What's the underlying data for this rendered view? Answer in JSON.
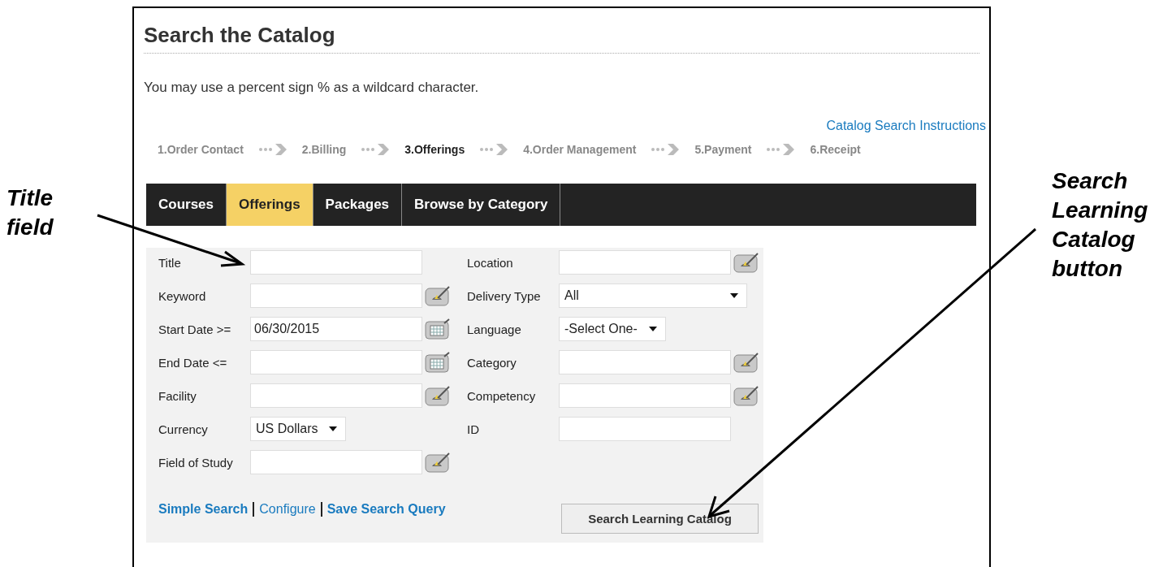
{
  "callouts": [
    {
      "text": "Title field"
    },
    {
      "text": "Search Learning Catalog button"
    }
  ],
  "page": {
    "title": "Search the Catalog",
    "hint": "You may use a percent sign % as a wildcard character.",
    "help_link": "Catalog Search Instructions"
  },
  "steps": [
    {
      "label": "1.Order Contact",
      "selected": false
    },
    {
      "label": "2.Billing",
      "selected": false
    },
    {
      "label": "3.Offerings",
      "selected": true
    },
    {
      "label": "4.Order Management",
      "selected": false
    },
    {
      "label": "5.Payment",
      "selected": false
    },
    {
      "label": "6.Receipt",
      "selected": false
    }
  ],
  "tabs": [
    {
      "label": "Courses",
      "selected": false
    },
    {
      "label": "Offerings",
      "selected": true
    },
    {
      "label": "Packages",
      "selected": false
    },
    {
      "label": "Browse by Category",
      "selected": false
    }
  ],
  "form": {
    "left": [
      {
        "label": "Title",
        "kind": "text"
      },
      {
        "label": "Keyword",
        "kind": "lookup"
      },
      {
        "label": "Start Date >=",
        "kind": "date",
        "value": "06/30/2015"
      },
      {
        "label": "End Date <=",
        "kind": "date"
      },
      {
        "label": "Facility",
        "kind": "lookup"
      },
      {
        "label": "Currency",
        "kind": "select",
        "value": "US Dollars"
      },
      {
        "label": "Field of Study",
        "kind": "lookup"
      }
    ],
    "right": [
      {
        "label": "Location",
        "kind": "lookup"
      },
      {
        "label": "Delivery Type",
        "kind": "wide-select",
        "value": "All"
      },
      {
        "label": "Language",
        "kind": "select",
        "value": "-Select One-"
      },
      {
        "label": "Category",
        "kind": "lookup"
      },
      {
        "label": "Competency",
        "kind": "lookup"
      },
      {
        "label": "ID",
        "kind": "text"
      }
    ],
    "links": [
      {
        "text": "Simple Search",
        "bold": true
      },
      {
        "text": "Configure",
        "bold": false
      },
      {
        "text": "Save Search Query",
        "bold": true
      }
    ],
    "button": "Search Learning Catalog"
  }
}
